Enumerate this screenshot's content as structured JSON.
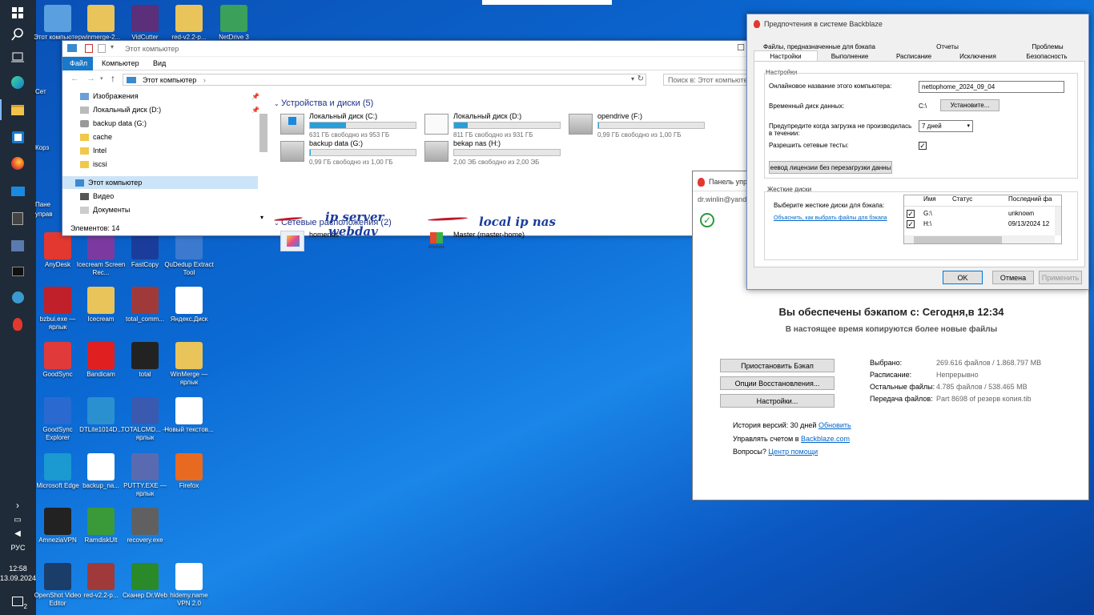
{
  "taskbar": {
    "language": "РУС",
    "time": "12:58",
    "date": "13.09.2024",
    "notification_count": "2"
  },
  "desktop": {
    "icons": [
      {
        "label": "Этот компьютер",
        "color": "#5aa0e0"
      },
      {
        "label": "winmerge-2...",
        "color": "#e8c45a"
      },
      {
        "label": "VidCutter",
        "color": "#5b2f7a"
      },
      {
        "label": "red-v2.2-p...",
        "color": "#e8c45a"
      },
      {
        "label": "NetDrive 3",
        "color": "#3aa05a"
      },
      {
        "label": "AnyDesk",
        "color": "#e2382f"
      },
      {
        "label": "Icecream Screen Rec...",
        "color": "#7c3aa0"
      },
      {
        "label": "FastCopy",
        "color": "#1a3d9c"
      },
      {
        "label": "QuDedup Extract Tool",
        "color": "#3c7ad0"
      },
      {
        "label": "bzbui.exe — ярлык",
        "color": "#c0202a"
      },
      {
        "label": "Icecream",
        "color": "#e8c45a"
      },
      {
        "label": "total_comm...",
        "color": "#a03a3a"
      },
      {
        "label": "Яндекс.Диск",
        "color": "#ffffff"
      },
      {
        "label": "GoodSync",
        "color": "#e03a3a"
      },
      {
        "label": "Bandicam",
        "color": "#e02020"
      },
      {
        "label": "total",
        "color": "#222222"
      },
      {
        "label": "WinMerge — ярлык",
        "color": "#e8c45a"
      },
      {
        "label": "GoodSync Explorer",
        "color": "#2a6ad0"
      },
      {
        "label": "DTLite1014D...",
        "color": "#2a90d0"
      },
      {
        "label": "TOTALCMD... — ярлык",
        "color": "#3a5ab0"
      },
      {
        "label": "Новый текстов...",
        "color": "#ffffff"
      },
      {
        "label": "Microsoft Edge",
        "color": "#1a9ad0"
      },
      {
        "label": "backup_na...",
        "color": "#ffffff"
      },
      {
        "label": "PUTTY.EXE — ярлык",
        "color": "#5a6ab0"
      },
      {
        "label": "Firefox",
        "color": "#e86a20"
      },
      {
        "label": "AmneziaVPN",
        "color": "#222222"
      },
      {
        "label": "RamdiskUlt",
        "color": "#3a9a3a"
      },
      {
        "label": "recovery.exe",
        "color": "#606060"
      },
      {
        "label": "OpenShot Video Editor",
        "color": "#1a3d6a"
      },
      {
        "label": "red-v2.2-p...",
        "color": "#a03a3a"
      },
      {
        "label": "Сканер Dr.Web",
        "color": "#2a8a2a"
      },
      {
        "label": "hidemy.name VPN 2.0",
        "color": "#ffffff"
      }
    ],
    "partial_labels": {
      "a": "Сет",
      "b": "Корз",
      "c": "Пане",
      "d": "управ"
    }
  },
  "explorer": {
    "title": "Этот компьютер",
    "tabs": [
      "Файл",
      "Компьютер",
      "Вид"
    ],
    "address": "Этот компьютер",
    "search_placeholder": "Поиск в: Этот компьютер",
    "nav": [
      {
        "label": "Изображения"
      },
      {
        "label": "Локальный диск (D:)"
      },
      {
        "label": "backup data (G:)"
      },
      {
        "label": "cache"
      },
      {
        "label": "Intel"
      },
      {
        "label": "iscsi"
      },
      {
        "label": "Этот компьютер"
      },
      {
        "label": "Видео"
      },
      {
        "label": "Документы"
      }
    ],
    "devices_header": "Устройства и диски (5)",
    "drives": [
      {
        "name": "Локальный диск (C:)",
        "free": "631 ГБ свободно из 953 ГБ",
        "used": 0.34
      },
      {
        "name": "Локальный диск (D:)",
        "free": "811 ГБ свободно из 931 ГБ",
        "used": 0.13
      },
      {
        "name": "opendrive (F:)",
        "free": "0,99 ГБ свободно из 1,00 ГБ",
        "used": 0.01
      },
      {
        "name": "backup data (G:)",
        "free": "0,99 ГБ свободно из 1,00 ГБ",
        "used": 0.01
      },
      {
        "name": "bekap nas (H:)",
        "free": "2,00 ЭБ свободно из 2,00 ЭБ",
        "used": 0.0
      }
    ],
    "network_header": "Сетевые расположения (2)",
    "network": [
      {
        "name": "homenas"
      },
      {
        "name": "Master (master-home)"
      }
    ],
    "status": "Элементов: 14",
    "annotations": {
      "ip_server": "ip server",
      "webdav": "webdav",
      "local_ip": "local ip nas"
    }
  },
  "bbpanel": {
    "title": "Панель упра",
    "email": "dr.winlin@yand",
    "headline": "Вы обеспечены бэкапом с: Сегодня,в 12:34",
    "subline": "В настоящее время копируются более новые файлы",
    "buttons": [
      "Приостановить Бэкап",
      "Опции Восстановления...",
      "Настройки..."
    ],
    "stats": [
      {
        "k": "Выбрано:",
        "v": "269.616 файлов / 1.868.797 MB"
      },
      {
        "k": "Расписание:",
        "v": "Непрерывно"
      },
      {
        "k": "Остальные файлы:",
        "v": "4.785 файлов / 538.465 MB"
      },
      {
        "k": "Передача файлов:",
        "v": "Part 8698 of резерв копия.tib"
      }
    ],
    "history_text": "История версий: 30 дней",
    "history_link": "Обновить",
    "account_text": "Управлять счетом в",
    "account_link": "Backblaze.com",
    "help_text": "Вопросы?",
    "help_link": "Центр помощи"
  },
  "prefs": {
    "title": "Предпочтения в системе Backblaze",
    "tabs_top": [
      "Файлы, предназначенные для бэкапа",
      "Отчеты",
      "Проблемы"
    ],
    "tabs_bottom": [
      "Настройки",
      "Выполнение",
      "Расписание",
      "Исключения",
      "Безопасность"
    ],
    "section_settings": "Настройки",
    "computer_name_label": "Онлайновое название этого компьютера:",
    "computer_name": "nettophome_2024_09_04",
    "temp_disk_label": "Временный диск данных:",
    "temp_disk": "C:\\",
    "set_button": "Установите...",
    "warn_label": "Предупредите когда загрузка не производилась в течении:",
    "warn_value": "7 дней",
    "network_test_label": "Разрешить сетевые тесты:",
    "license_button": "еевод лицензии без перезагрузки данны",
    "section_disks": "Жесткие диски",
    "select_disks_label": "Выберите жесткие диски для бэкапа:",
    "explain_link": "Объяснить, как выбрать файлы для бэкапа",
    "columns": [
      "Имя",
      "Статус",
      "Последний фа"
    ],
    "rows": [
      {
        "name": "G:\\",
        "status": "",
        "last": "unknown"
      },
      {
        "name": "H:\\",
        "status": "",
        "last": "09/13/2024 12"
      }
    ],
    "ok": "OK",
    "cancel": "Отмена",
    "apply": "Применить"
  }
}
